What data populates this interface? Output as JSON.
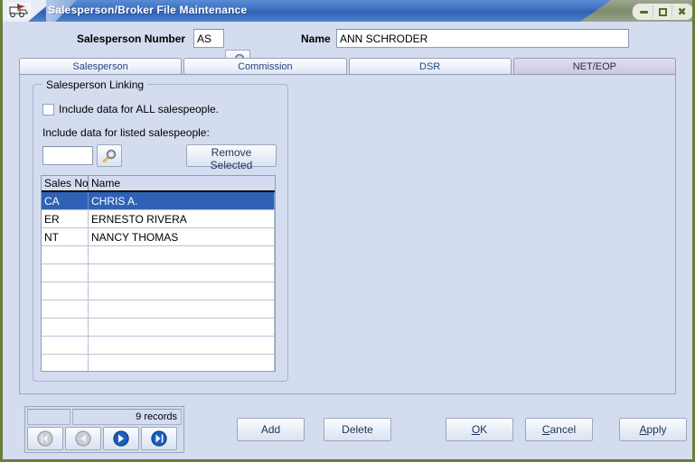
{
  "window": {
    "title": "Salesperson/Broker File Maintenance",
    "app_icon": "cart-flag-icon",
    "controls": {
      "minimize": "minimize-icon",
      "maximize": "maximize-icon",
      "close": "close-icon"
    }
  },
  "header": {
    "salesperson_number_label": "Salesperson Number",
    "salesperson_number_value": "AS",
    "salesperson_lookup_icon": "magnifier-icon",
    "name_label": "Name",
    "name_value": "ANN SCHRODER",
    "name_placeholder": ""
  },
  "tabs": [
    {
      "label": "Salesperson",
      "selected": false
    },
    {
      "label": "Commission",
      "selected": false
    },
    {
      "label": "DSR",
      "selected": false
    },
    {
      "label": "NET/EOP",
      "selected": true
    }
  ],
  "group": {
    "title": "Salesperson Linking",
    "include_all_checkbox_label": "Include data for ALL salespeople.",
    "include_all_checked": false,
    "listed_label": "Include data for listed salespeople:",
    "link_code_value": "",
    "link_code_placeholder": "",
    "link_lookup_icon": "magnifier-icon",
    "remove_selected_label": "Remove Selected"
  },
  "grid": {
    "columns": [
      "Sales No",
      "Name"
    ],
    "rows": [
      {
        "sales_no": "CA",
        "name": "CHRIS A.",
        "selected": true
      },
      {
        "sales_no": "ER",
        "name": "ERNESTO RIVERA",
        "selected": false
      },
      {
        "sales_no": "NT",
        "name": "NANCY THOMAS",
        "selected": false
      },
      {
        "sales_no": "",
        "name": "",
        "selected": false
      },
      {
        "sales_no": "",
        "name": "",
        "selected": false
      },
      {
        "sales_no": "",
        "name": "",
        "selected": false
      },
      {
        "sales_no": "",
        "name": "",
        "selected": false
      },
      {
        "sales_no": "",
        "name": "",
        "selected": false
      },
      {
        "sales_no": "",
        "name": "",
        "selected": false
      },
      {
        "sales_no": "",
        "name": "",
        "selected": false
      },
      {
        "sales_no": "",
        "name": "",
        "selected": false
      }
    ]
  },
  "record_nav": {
    "status_left": "",
    "status_right": "9 records",
    "buttons": [
      {
        "name": "first-record",
        "icon": "first-arrow-icon",
        "enabled": false
      },
      {
        "name": "previous-record",
        "icon": "previous-arrow-icon",
        "enabled": false
      },
      {
        "name": "next-record",
        "icon": "next-arrow-icon",
        "enabled": true
      },
      {
        "name": "last-record",
        "icon": "last-arrow-icon",
        "enabled": true
      }
    ]
  },
  "actions": {
    "add": "Add",
    "delete": "Delete",
    "ok": "OK",
    "ok_mnemonic": "O",
    "ok_rest": "K",
    "cancel": "Cancel",
    "cancel_mnemonic": "C",
    "cancel_rest": "ancel",
    "apply": "Apply",
    "apply_mnemonic": "A",
    "apply_rest": "pply"
  },
  "colors": {
    "panel_background": "#d4dcf0",
    "titlebar_blue": "#3a6ec0",
    "selection_blue": "#2f62b6",
    "window_border_olive": "#6b7d3a",
    "selected_tab": "#d7d1e8"
  }
}
